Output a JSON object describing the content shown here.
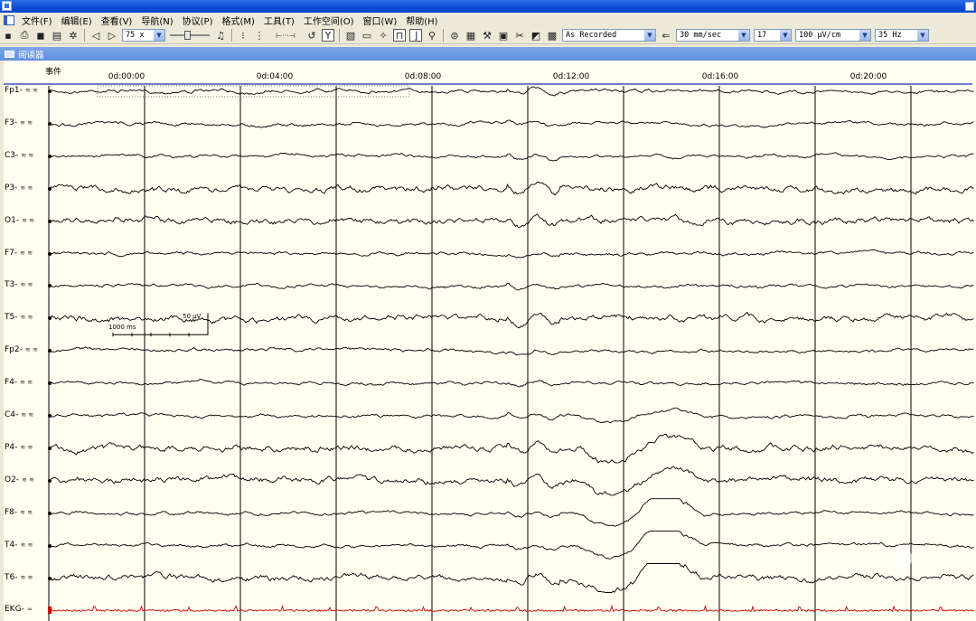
{
  "menu": [
    "文件(F)",
    "编辑(E)",
    "查看(V)",
    "导航(N)",
    "协议(P)",
    "格式(M)",
    "工具(T)",
    "工作空间(O)",
    "窗口(W)",
    "帮助(H)"
  ],
  "toolbar": {
    "zoom": "75 x",
    "montage": "As Recorded",
    "speed": "30 mm/sec",
    "channels": "17",
    "sensitivity": "100 µV/cm",
    "filter": "35 Hz"
  },
  "document_title": "阅读器",
  "timebar": {
    "event_label": "事件",
    "time_labels": [
      "0d:00:00",
      "0d:04:00",
      "0d:08:00",
      "0d:12:00",
      "0d:16:00",
      "0d:20:00"
    ]
  },
  "channels": [
    "Fp1-",
    "F3-",
    "C3-",
    "P3-",
    "O1-",
    "F7-",
    "T3-",
    "T5-",
    "Fp2-",
    "F4-",
    "C4-",
    "P4-",
    "O2-",
    "F8-",
    "T4-",
    "T6-",
    "EKG-"
  ],
  "scale_bar": {
    "time": "1000 ms",
    "amplitude": "50 µV"
  },
  "colors": {
    "trace": "#000000",
    "ekg": "#cc0000",
    "background": "#fffef0",
    "gridline": "#000000"
  }
}
